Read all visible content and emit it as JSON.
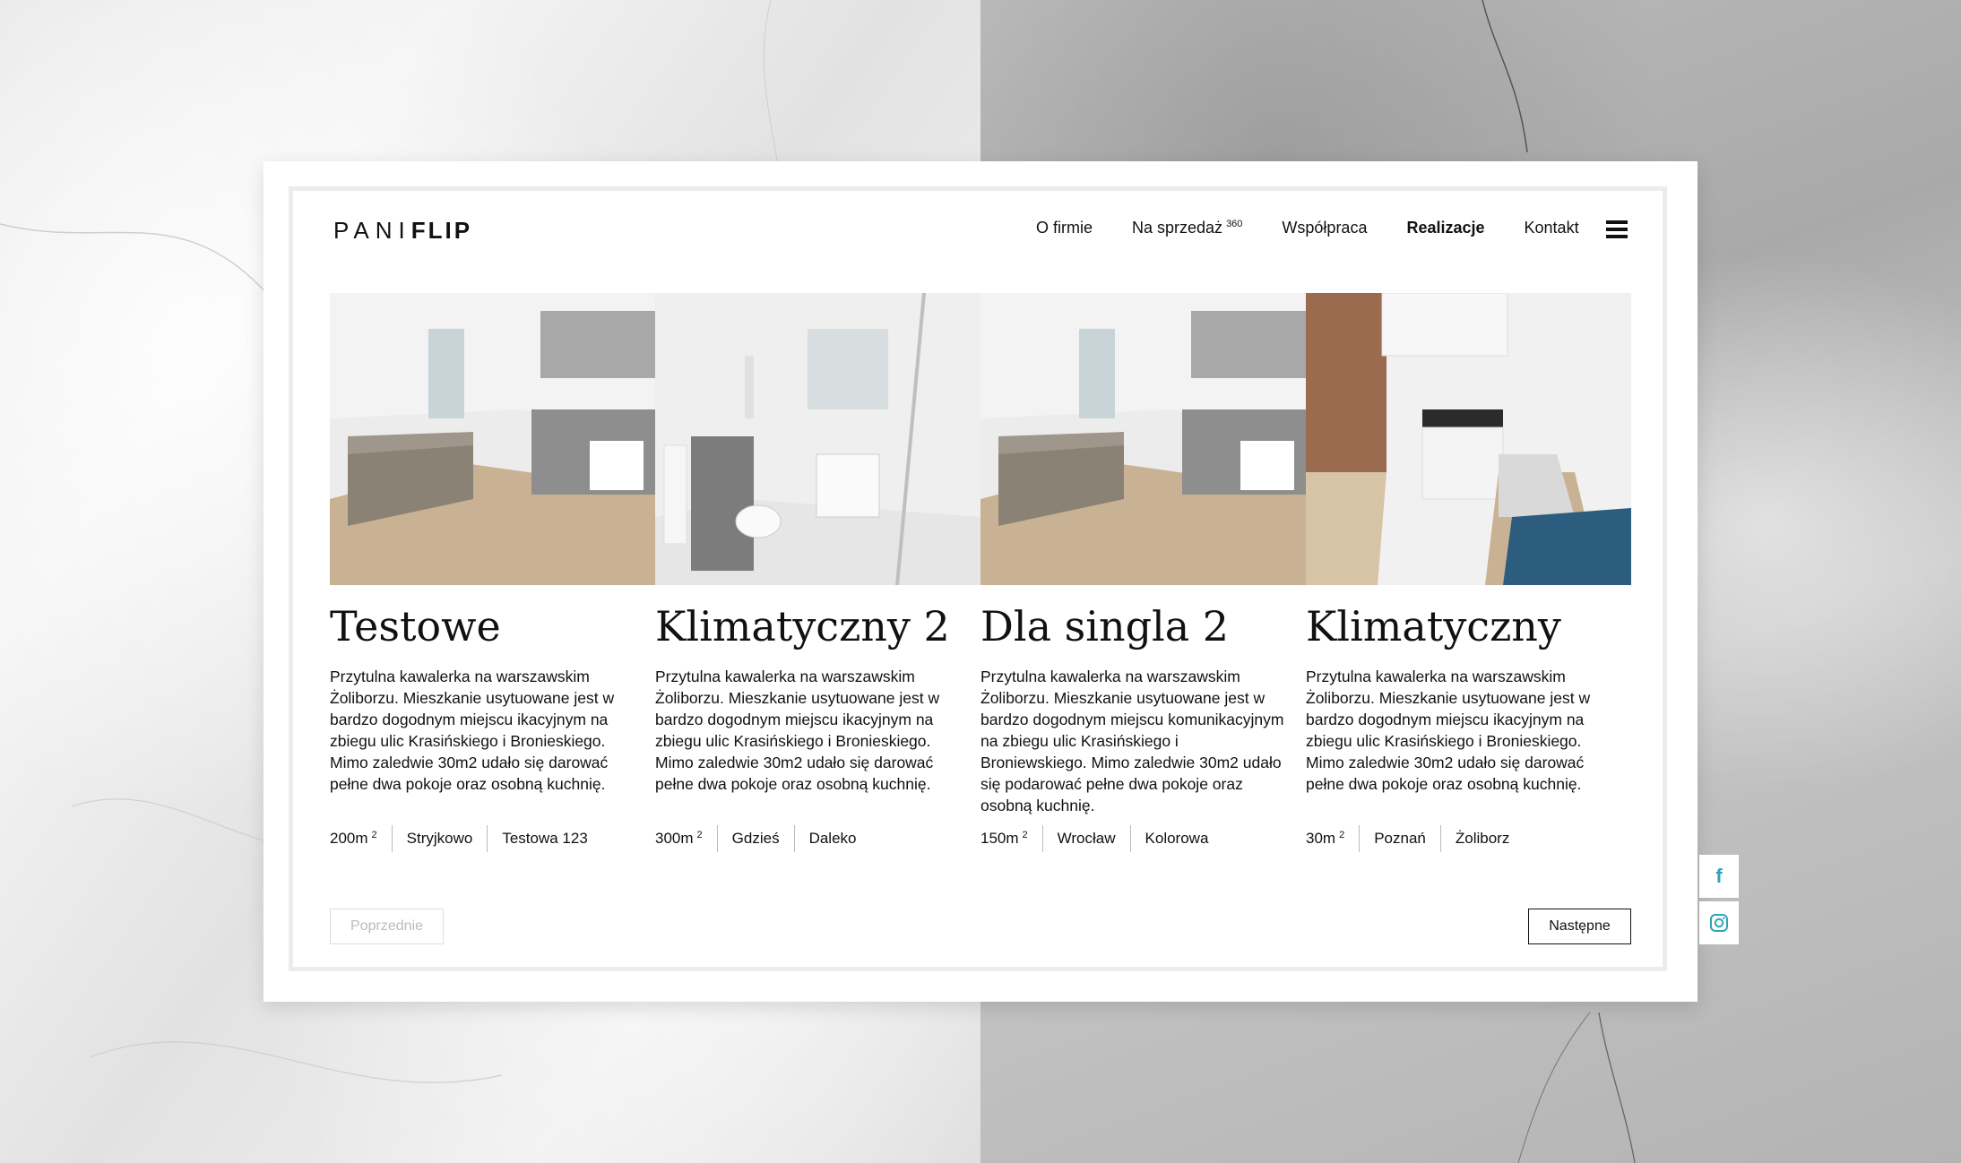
{
  "brand": {
    "logo_light": "PANI",
    "logo_bold": "FLIP"
  },
  "nav": {
    "items": [
      {
        "label": "O firmie"
      },
      {
        "label": "Na sprzedaż",
        "sup": "360"
      },
      {
        "label": "Współpraca"
      },
      {
        "label": "Realizacje",
        "active": true
      },
      {
        "label": "Kontakt"
      }
    ],
    "menu_icon": "hamburger-menu-icon"
  },
  "listings": [
    {
      "title": "Testowe",
      "description": "Przytulna kawalerka na warszawskim Żoliborzu. Mieszkanie usytuowane jest w bardzo dogodnym miejscu ikacyjnym na zbiegu ulic Krasińskiego i Bronieskiego. Mimo zaledwie 30m2 udało się darować pełne dwa pokoje oraz osobną kuchnię.",
      "area": "200m",
      "area_sup": "2",
      "city": "Stryjkowo",
      "street": "Testowa 123",
      "photo": "living-room-kitchen"
    },
    {
      "title": "Klimatyczny 2",
      "description": "Przytulna kawalerka na warszawskim Żoliborzu. Mieszkanie usytuowane jest w bardzo dogodnym miejscu ikacyjnym na zbiegu ulic Krasińskiego i Bronieskiego. Mimo zaledwie 30m2 udało się darować pełne dwa pokoje oraz osobną kuchnię.",
      "area": "300m",
      "area_sup": "2",
      "city": "Gdzieś",
      "street": "Daleko",
      "photo": "bathroom"
    },
    {
      "title": "Dla singla 2",
      "description": "Przytulna kawalerka na warszawskim Żoliborzu. Mieszkanie usytuowane jest w bardzo dogodnym miejscu komunikacyjnym na zbiegu ulic Krasińskiego i Broniewskiego. Mimo zaledwie 30m2 udało się podarować pełne dwa pokoje oraz osobną kuchnię.",
      "area": "150m",
      "area_sup": "2",
      "city": "Wrocław",
      "street": "Kolorowa",
      "photo": "living-room-kitchen"
    },
    {
      "title": "Klimatyczny",
      "description": "Przytulna kawalerka na warszawskim Żoliborzu. Mieszkanie usytuowane jest w bardzo dogodnym miejscu ikacyjnym na zbiegu ulic Krasińskiego i Bronieskiego. Mimo zaledwie 30m2 udało się darować pełne dwa pokoje oraz osobną kuchnię.",
      "area": "30m",
      "area_sup": "2",
      "city": "Poznań",
      "street": "Żoliborz",
      "photo": "kitchen-brick-wall"
    }
  ],
  "pagination": {
    "prev_label": "Poprzednie",
    "next_label": "Następne"
  },
  "social": [
    {
      "icon": "facebook-icon",
      "glyph": "f"
    },
    {
      "icon": "instagram-icon"
    }
  ],
  "colors": {
    "accent_social": "#2ba6b8",
    "text": "#111111",
    "frame": "#ececec"
  }
}
